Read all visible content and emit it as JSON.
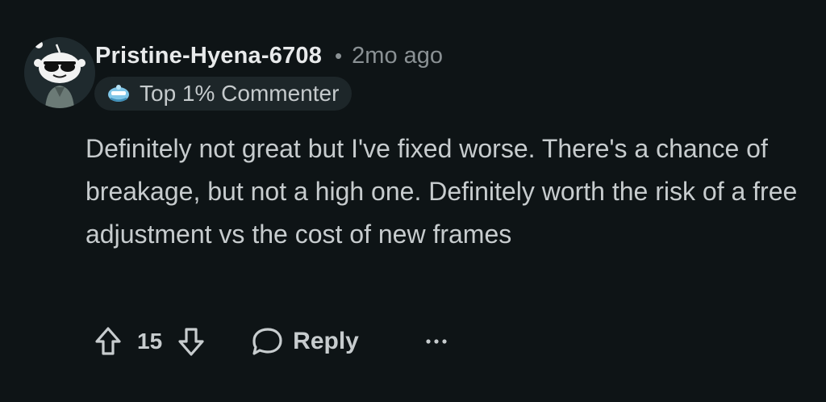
{
  "comment": {
    "username": "Pristine-Hyena-6708",
    "separator": "•",
    "timestamp": "2mo ago",
    "badge": {
      "icon": "commenter-badge-icon",
      "label": "Top 1% Commenter"
    },
    "body": "Definitely not great but I've fixed worse. There's a chance of breakage, but not a high one. Definitely worth the risk of a free adjustment vs the cost of new frames"
  },
  "actions": {
    "upvote_icon": "upvote-arrow-icon",
    "score": "15",
    "downvote_icon": "downvote-arrow-icon",
    "reply_icon": "speech-bubble-icon",
    "reply_label": "Reply",
    "more_icon": "ellipsis-icon"
  },
  "colors": {
    "background": "#0e1416",
    "text": "#c7ccce",
    "muted": "#8a9194",
    "badge_bg": "#1d2629"
  }
}
